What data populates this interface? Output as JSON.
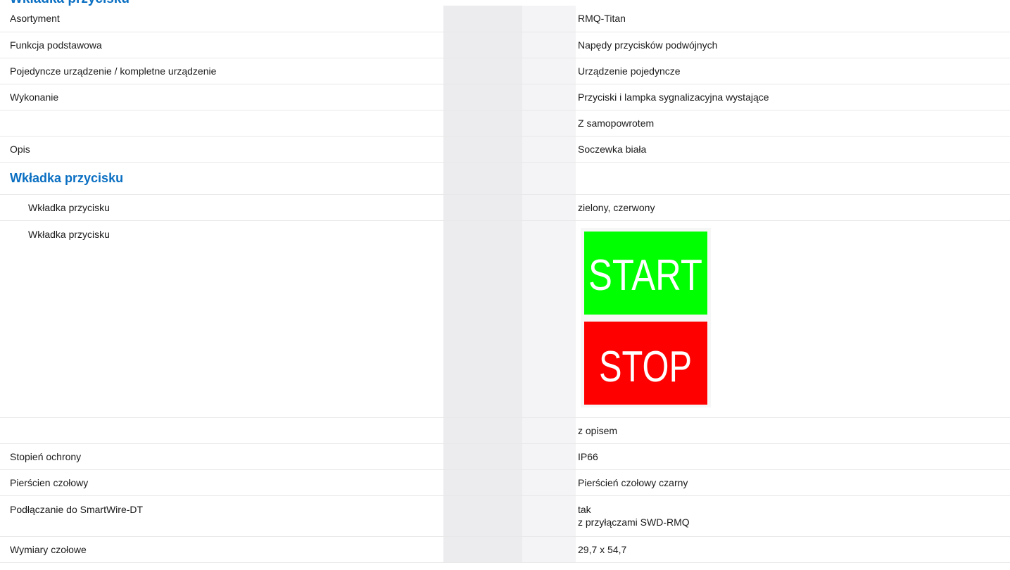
{
  "rows": [
    {
      "label": "Asortyment",
      "value": "RMQ-Titan"
    },
    {
      "label": "Funkcja podstawowa",
      "value": "Napędy przycisków podwójnych"
    },
    {
      "label": "Pojedyncze urządzenie / kompletne urządzenie",
      "value": "Urządzenie pojedyncze"
    },
    {
      "label": "Wykonanie",
      "value": "Przyciski i lampka sygnalizacyjna wystające"
    },
    {
      "label": "",
      "value": "Z samopowrotem"
    },
    {
      "label": "Opis",
      "value": "Soczewka biała"
    }
  ],
  "group": {
    "title": "Wkładka przycisku",
    "rows": [
      {
        "label": "Wkładka przycisku",
        "value": "zielony, czerwony"
      },
      {
        "label": "Wkładka przycisku",
        "image_top_text": "START",
        "image_bottom_text": "STOP",
        "image_top_color": "#00ff00",
        "image_bottom_color": "#ff0000"
      },
      {
        "label": "",
        "value": "z opisem"
      }
    ]
  },
  "rows2": [
    {
      "label": "Stopień ochrony",
      "value": "IP66"
    },
    {
      "label": "Pierścien czołowy",
      "value": "Pierścień czołowy czarny"
    },
    {
      "label": "Podłączanie do SmartWire-DT",
      "value_line1": "tak",
      "value_line2": "z przyłączami SWD-RMQ"
    },
    {
      "label": "Wymiary czołowe",
      "value": "29,7 x 54,7"
    }
  ],
  "colors": {
    "accent": "#0a6fc2"
  }
}
